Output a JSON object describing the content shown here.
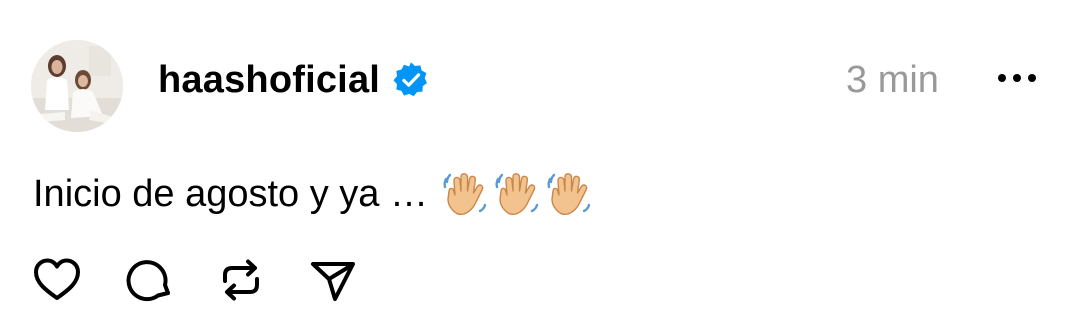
{
  "post": {
    "username": "haashoficial",
    "verified": true,
    "timestamp": "3 min",
    "caption_text": "Inicio de agosto y ya …",
    "caption_emoji": [
      "waving-hand",
      "waving-hand",
      "waving-hand"
    ]
  },
  "icons": {
    "verified": "verified-badge-icon",
    "more": "more-options-icon",
    "like": "heart-icon",
    "comment": "comment-icon",
    "repost": "repost-icon",
    "share": "send-icon"
  },
  "colors": {
    "verified_blue": "#0095f6",
    "timestamp_gray": "#999999",
    "text": "#000000"
  }
}
